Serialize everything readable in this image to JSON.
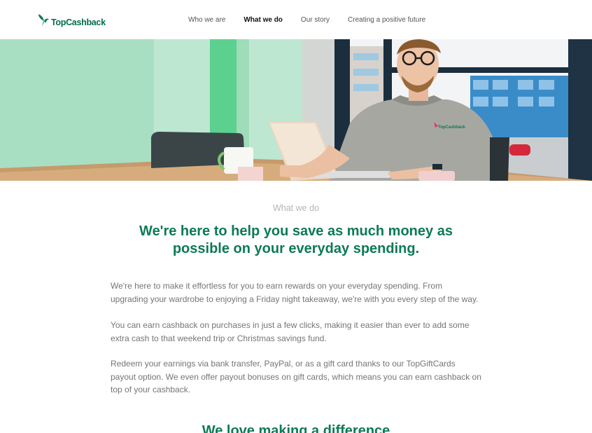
{
  "brand": {
    "name": "TopCashback",
    "primary_color": "#0c7a57",
    "accent_color": "#e8335c"
  },
  "nav": {
    "items": [
      {
        "label": "Who we are"
      },
      {
        "label": "What we do",
        "active": true
      },
      {
        "label": "Our story"
      },
      {
        "label": "Creating a positive future"
      }
    ]
  },
  "hero": {
    "shirt_logo_text": "TopCashback"
  },
  "main": {
    "section_label": "What we do",
    "headline": "We're here to help you save as much money as possible on your everyday spending.",
    "paragraphs": [
      "We're here to make it effortless for you to earn rewards on your everyday spending. From upgrading your wardrobe to enjoying a Friday night takeaway, we're with you every step of the way.",
      "You can earn cashback on purchases in just a few clicks, making it easier than ever to add some extra cash to that weekend trip or Christmas savings fund.",
      "Redeem your earnings via bank transfer, PayPal, or as a gift card thanks to our TopGiftCards payout option. We even offer payout bonuses on gift cards, which means you can earn cashback on top of your cashback."
    ],
    "next_headline": "We love making a difference"
  }
}
